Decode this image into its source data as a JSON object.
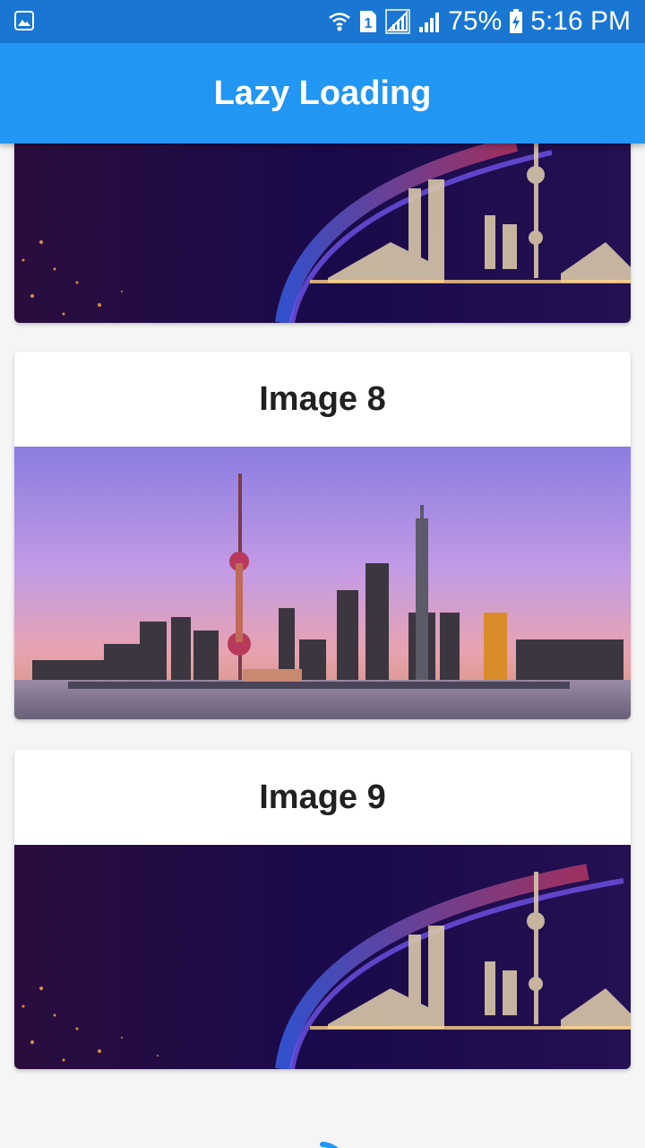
{
  "status_bar": {
    "battery_percent": "75%",
    "time": "5:16 PM",
    "sim_label": "1",
    "icons": [
      "gallery-icon",
      "wifi-icon",
      "sim-icon",
      "signal-icon",
      "signal-icon",
      "battery-charging-icon"
    ]
  },
  "app_bar": {
    "title": "Lazy Loading"
  },
  "cards": [
    {
      "title": "",
      "image": "night-skyline-banner"
    },
    {
      "title": "Image 8",
      "image": "sunset-skyline"
    },
    {
      "title": "Image 9",
      "image": "night-skyline-banner"
    }
  ],
  "colors": {
    "app_bar": "#2196f3",
    "status_bar": "#1976d2",
    "spinner": "#2196f3"
  }
}
